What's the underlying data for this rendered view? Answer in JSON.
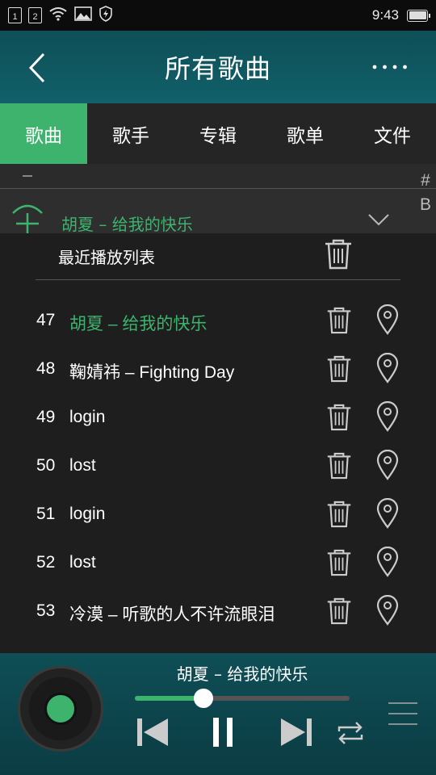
{
  "status_bar": {
    "sim1": "1",
    "sim2": "2",
    "time": "9:43"
  },
  "header": {
    "title": "所有歌曲",
    "back_icon": "chevron-left-icon",
    "more_icon": "more-dots-icon"
  },
  "tabs": [
    {
      "label": "歌曲",
      "active": true
    },
    {
      "label": "歌手",
      "active": false
    },
    {
      "label": "专辑",
      "active": false
    },
    {
      "label": "歌单",
      "active": false
    },
    {
      "label": "文件",
      "active": false
    }
  ],
  "song_list": {
    "playing_song": "胡夏 – 给我的快乐",
    "index_letters": [
      "#",
      "B"
    ]
  },
  "popup": {
    "title": "最近播放列表",
    "items": [
      {
        "number": "47",
        "title": "胡夏 – 给我的快乐",
        "current": true
      },
      {
        "number": "48",
        "title": "鞠婧祎 – Fighting Day",
        "current": false
      },
      {
        "number": "49",
        "title": "login",
        "current": false
      },
      {
        "number": "50",
        "title": "lost",
        "current": false
      },
      {
        "number": "51",
        "title": "login",
        "current": false
      },
      {
        "number": "52",
        "title": "lost",
        "current": false
      },
      {
        "number": "53",
        "title": "冷漠 – 听歌的人不许流眼泪",
        "current": false
      }
    ]
  },
  "player": {
    "now_playing": "胡夏 – 给我的快乐",
    "progress": 0.32,
    "accent": "#3db36e"
  }
}
